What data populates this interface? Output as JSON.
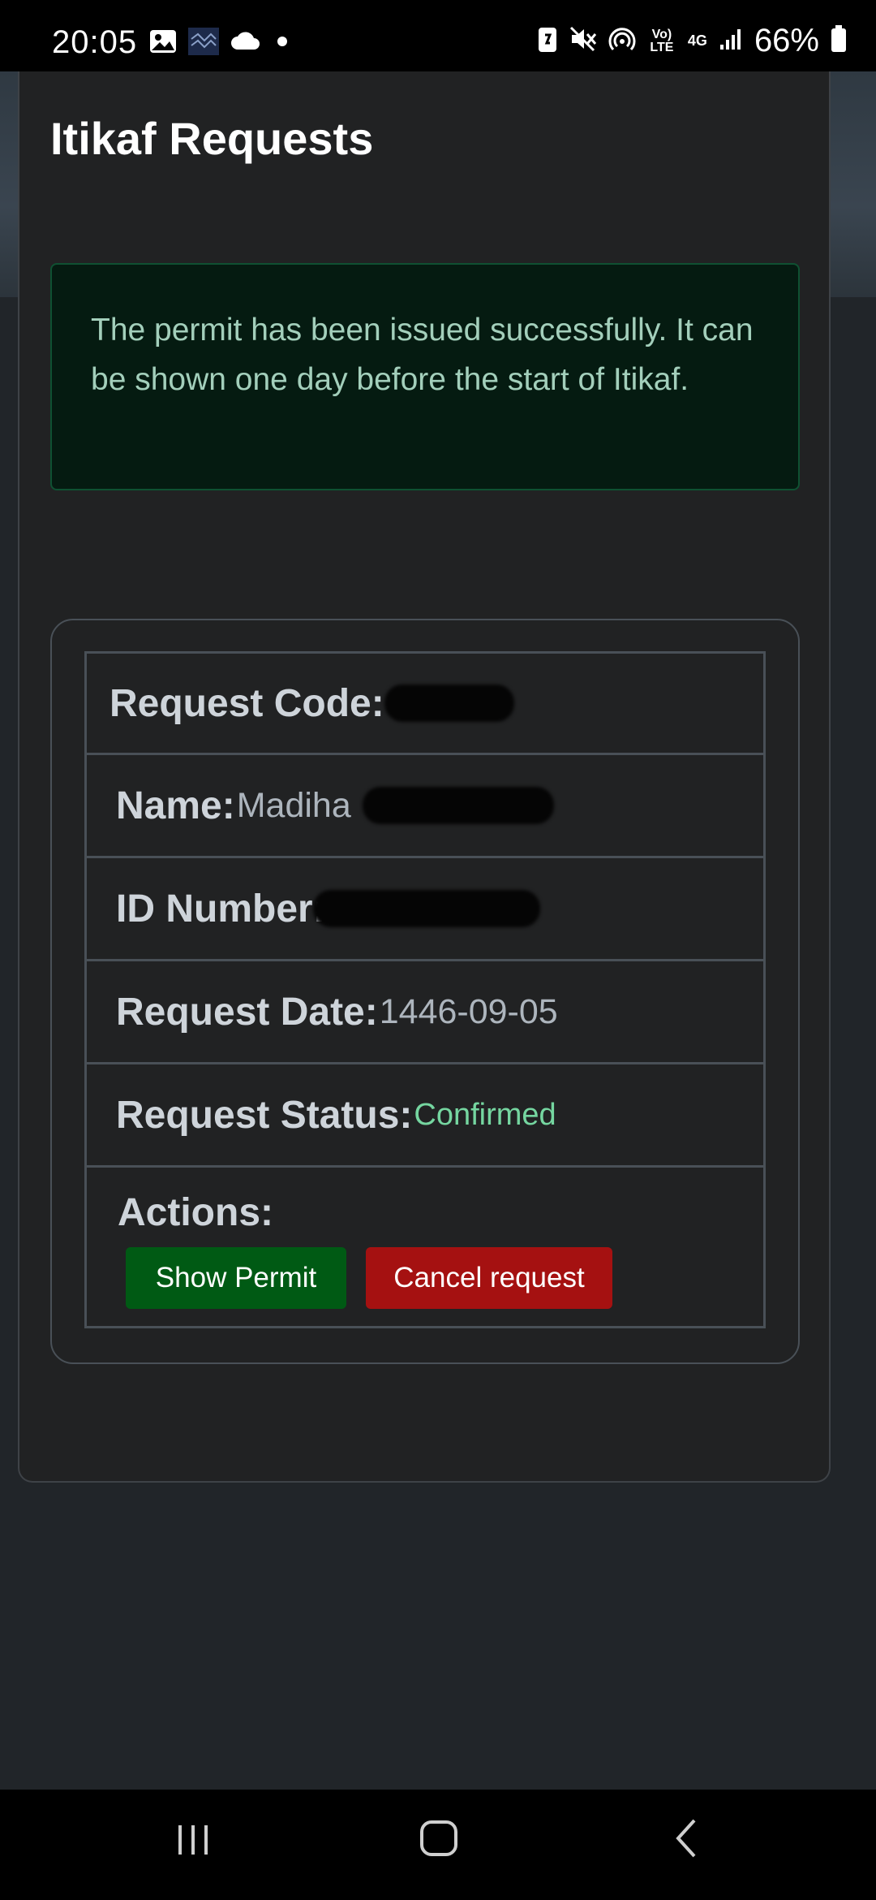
{
  "status_bar": {
    "time": "20:05",
    "battery": "66%",
    "icons": [
      "image-icon",
      "app-icon",
      "cloud-icon",
      "dot-icon",
      "battery-saver-icon",
      "mute-icon",
      "hotspot-icon",
      "volte-icon",
      "4g-icon",
      "signal-icon",
      "battery-icon"
    ],
    "volte_label": "Vo) LTE",
    "net_label": "4G"
  },
  "page": {
    "title": "Itikaf Requests"
  },
  "alert": {
    "message": "The permit has been issued successfully. It can be shown one day before the start of Itikaf."
  },
  "request": {
    "code_label": "Request Code:",
    "name_label": "Name:",
    "name_value": "Madiha",
    "id_label": "ID Number:",
    "date_label": "Request Date:",
    "date_value": "1446-09-05",
    "status_label": "Request Status:",
    "status_value": "Confirmed",
    "actions_label": "Actions:"
  },
  "actions": {
    "show_permit": "Show Permit",
    "cancel_request": "Cancel request"
  },
  "colors": {
    "status_confirmed": "#75d6a0",
    "show_permit_bg": "#005a14",
    "cancel_bg": "#a51111"
  },
  "nav_bar": {
    "icons": [
      "recents-icon",
      "home-icon",
      "back-icon"
    ]
  }
}
